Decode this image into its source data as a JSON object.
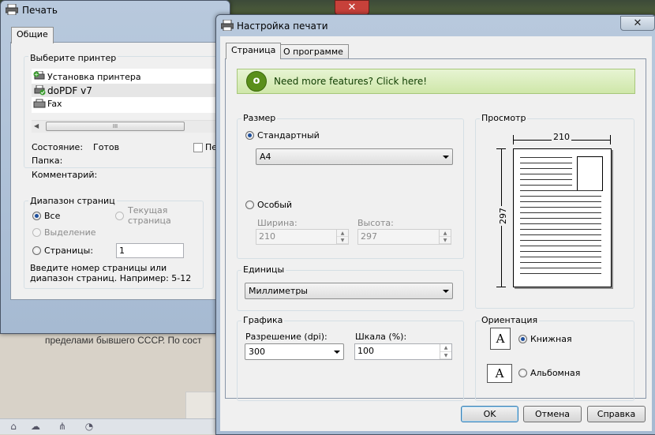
{
  "background": {
    "text": "пределами бывшего СССР. По сост"
  },
  "print_dialog": {
    "title": "Печать",
    "tab_general": "Общие",
    "select_printer_label": "Выберите принтер",
    "printers": [
      {
        "name": "Установка принтера",
        "icon": "add-printer-icon"
      },
      {
        "name": "doPDF v7",
        "icon": "printer-default-icon"
      },
      {
        "name": "Fax",
        "icon": "fax-icon"
      }
    ],
    "status_label": "Состояние:",
    "status_value": "Готов",
    "folder_label": "Папка:",
    "comment_label": "Комментарий:",
    "print_to_file_partial": "Пе",
    "page_range_label": "Диапазон страниц",
    "range_all": "Все",
    "range_current": "Текущая страница",
    "range_selection": "Выделение",
    "range_pages": "Страницы:",
    "range_pages_value": "1",
    "range_hint": "Введите номер страницы или диапазон страниц.  Например: 5-12",
    "scroll_grip": "III"
  },
  "setup_dialog": {
    "title": "Настройка печати",
    "tabs": [
      "Страница",
      "О программе"
    ],
    "promo_text": "Need more features? Click here!",
    "size_label": "Размер",
    "standard_label": "Стандартный",
    "standard_value": "A4",
    "custom_label": "Особый",
    "width_label": "Ширина:",
    "width_value": "210",
    "height_label": "Высота:",
    "height_value": "297",
    "units_label": "Единицы",
    "units_value": "Миллиметры",
    "graphics_label": "Графика",
    "resolution_label": "Разрешение (dpi):",
    "resolution_value": "300",
    "scale_label": "Шкала (%):",
    "scale_value": "100",
    "preview_label": "Просмотр",
    "preview_width": "210",
    "preview_height": "297",
    "orientation_label": "Ориентация",
    "portrait_label": "Книжная",
    "landscape_label": "Альбомная",
    "orientation_icon_letter": "A",
    "ok": "OK",
    "cancel": "Отмена",
    "help": "Справка"
  },
  "colors": {
    "accent_blue": "#1e4f9c",
    "promo_green": "#5a8f1a",
    "close_red": "#c7413a"
  }
}
